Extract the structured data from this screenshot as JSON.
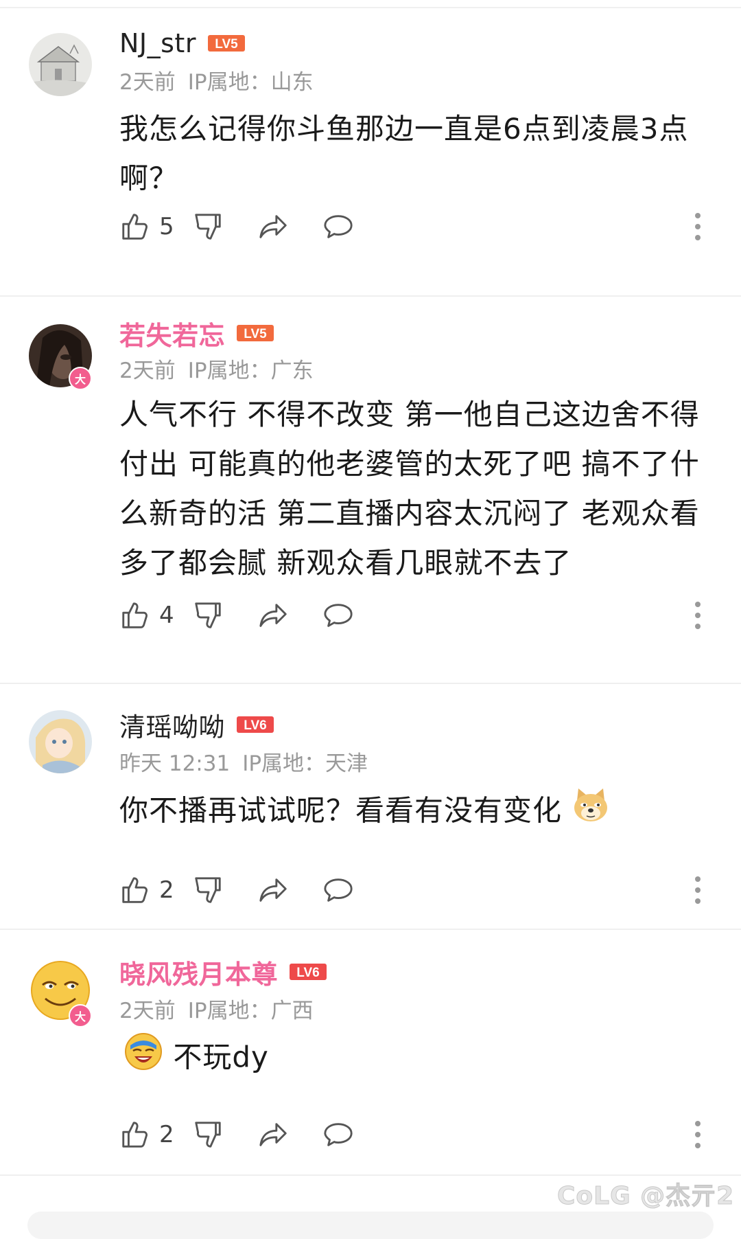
{
  "comments": [
    {
      "username": "NJ_str",
      "level": "LV5",
      "level_color": "#f26a3d",
      "time": "2天前",
      "ip": "IP属地：山东",
      "content": "我怎么记得你斗鱼那边一直是6点到凌晨3点啊？",
      "likes": "5",
      "vip": false
    },
    {
      "username": "若失若忘",
      "level": "LV5",
      "level_color": "#f26a3d",
      "time": "2天前",
      "ip": "IP属地：广东",
      "content": "人气不行 不得不改变 第一他自己这边舍不得付出 可能真的他老婆管的太死了吧 搞不了什么新奇的活  第二直播内容太沉闷了 老观众看多了都会腻 新观众看几眼就不去了",
      "likes": "4",
      "vip": true,
      "vip_badge": "大"
    },
    {
      "username": "清瑶呦呦",
      "level": "LV6",
      "level_color": "#ee4a4a",
      "time": "昨天 12:31",
      "ip": "IP属地：天津",
      "content": "你不播再试试呢？看看有没有变化",
      "likes": "2",
      "vip": false
    },
    {
      "username": "晓风残月本尊",
      "level": "LV6",
      "level_color": "#ee4a4a",
      "time": "2天前",
      "ip": "IP属地：广西",
      "content": "不玩dy",
      "likes": "2",
      "vip": true,
      "vip_badge": "大"
    }
  ],
  "watermark": "CoLG @杰亓2",
  "colors": {
    "vip_name": "#f0679a",
    "meta": "#999999",
    "icon": "#555555"
  }
}
